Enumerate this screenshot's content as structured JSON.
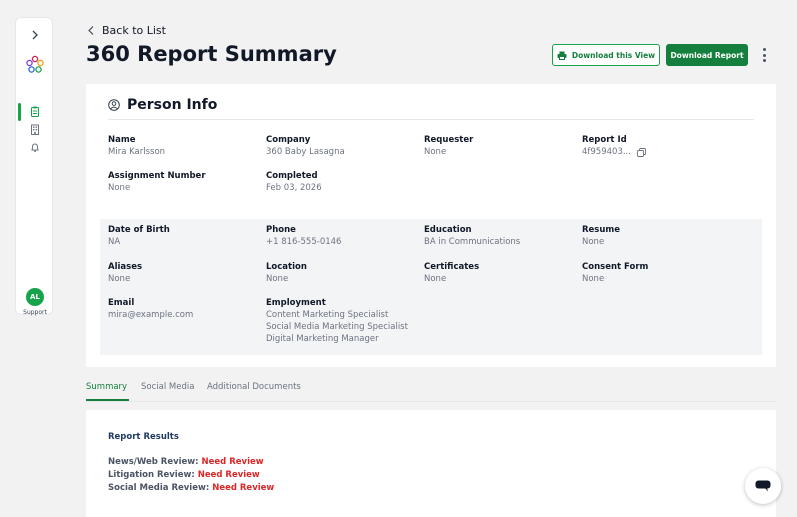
{
  "sidebar": {
    "expand_icon": "chevron-right-icon",
    "logo_icon": "flower-logo-icon",
    "items": [
      {
        "icon": "clipboard-icon",
        "active": true
      },
      {
        "icon": "building-icon",
        "active": false
      },
      {
        "icon": "bell-icon",
        "active": false
      }
    ],
    "avatar_initials": "AL",
    "support_label": "Support"
  },
  "header": {
    "back_label": "Back to List",
    "title": "360 Report Summary",
    "download_view_label": "Download this View",
    "download_report_label": "Download Report"
  },
  "person_info": {
    "title": "Person Info",
    "fields": {
      "name": {
        "label": "Name",
        "value": "Mira Karlsson"
      },
      "company": {
        "label": "Company",
        "value": "360 Baby Lasagna"
      },
      "requester": {
        "label": "Requester",
        "value": "None"
      },
      "report_id": {
        "label": "Report Id",
        "value": "4f959403..."
      },
      "assignment_number": {
        "label": "Assignment Number",
        "value": "None"
      },
      "completed": {
        "label": "Completed",
        "value": "Feb 03, 2026"
      }
    },
    "details": {
      "dob": {
        "label": "Date of Birth",
        "value": "NA"
      },
      "phone": {
        "label": "Phone",
        "value": "+1 816-555-0146"
      },
      "education": {
        "label": "Education",
        "value": "BA in Communications"
      },
      "resume": {
        "label": "Resume",
        "value": "None"
      },
      "aliases": {
        "label": "Aliases",
        "value": "None"
      },
      "location": {
        "label": "Location",
        "value": "None"
      },
      "certificates": {
        "label": "Certificates",
        "value": "None"
      },
      "consent_form": {
        "label": "Consent Form",
        "value": "None"
      },
      "email": {
        "label": "Email",
        "value": "mira@example.com"
      },
      "employment": {
        "label": "Employment",
        "values": [
          "Content Marketing Specialist",
          "Social Media Marketing Specialist",
          "Digital Marketing Manager"
        ]
      }
    }
  },
  "tabs": [
    {
      "label": "Summary",
      "active": true
    },
    {
      "label": "Social Media",
      "active": false
    },
    {
      "label": "Additional Documents",
      "active": false
    }
  ],
  "report_results": {
    "title": "Report Results",
    "items": [
      {
        "label": "News/Web Review:",
        "status": "Need Review"
      },
      {
        "label": "Litigation Review:",
        "status": "Need Review"
      },
      {
        "label": "Social Media Review:",
        "status": "Need Review"
      }
    ]
  },
  "colors": {
    "accent": "#15803d",
    "status_alert": "#dc2626"
  }
}
